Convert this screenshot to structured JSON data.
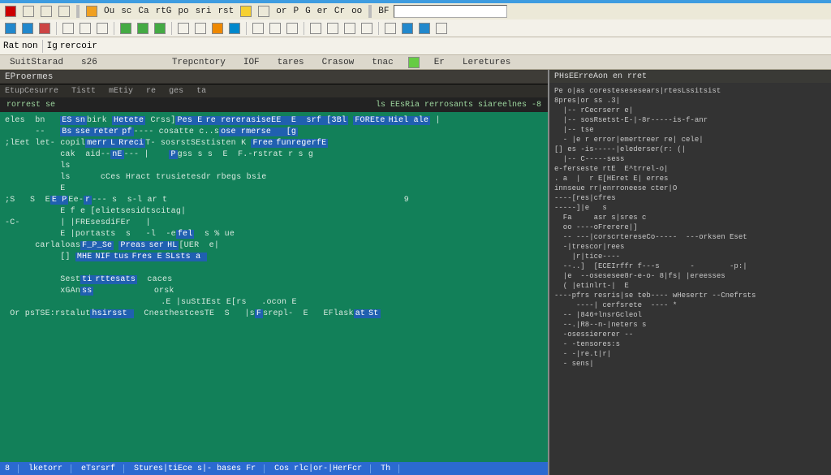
{
  "menubar": [
    "Ou",
    "sc",
    "Ca",
    "rtG",
    "po",
    "sri",
    "rst",
    "or",
    "P",
    "G",
    "er",
    "Cr",
    "oo",
    "BF"
  ],
  "toolbar2": [
    "Rat",
    "non",
    "Ig",
    "rercoir"
  ],
  "tabrow": [
    "SuitStarad",
    "s26",
    "Trepcntory",
    "IOF",
    "tares",
    "Crasow",
    "tnac",
    "Er",
    "Leretures"
  ],
  "panel": {
    "title": "EProermes",
    "sub": [
      "EtupCesurre",
      "Tistt",
      "mEtiy",
      "re",
      "ges",
      "ta"
    ],
    "head_left": "rorrest se",
    "head_right": "ls EEsRia rerrosants siareelnes -8"
  },
  "editor_lines": [
    "eles  bn   [ES][sn]birk [Hetete] Crss][Pes E][re rererasiseEE  E  srf [3Bl] [FOREte][Hiel ale] |",
    "      --   [Bs][sse][reter][pf]---- cosatte c..s[ose rmerse   [g]                              ",
    ";lEet let- copil[merr][L][Rreci]T- sosrstSEstisten K [Free][funregerfE]                         ",
    "           cak  aid--[nE]--- |    [P]gss s s  E  F.-rstrat r s g                                ",
    "           ls                                                                                   ",
    "           ls      cCes Hract trusietesdr rbegs bsie                                            ",
    "           E                                                                                    ",
    ";S   S  E[E P]Ee-[r]--- s  s-l ar t                                               9             ",
    "           E f e [elietsesidtscitag|                                                            ",
    "-C-        | |FREsesdiFEr   |                                                                   ",
    "           E |portasts  s   -l  -e[fel]  s % ue                                                 ",
    "      carlaloas[F_P_Se] [Preas][ser][HL][UER  e|                                                ",
    "           [] [MHE][NIF][tus][Fres E][SLsts a ]                                                 ",
    "                                                                                                ",
    "           Sest[ti][rttesats]  caces                                                            ",
    "           xGAn[ss]            orsk                                                             ",
    "                               .E |suStIEst E[rs   .ocon E                                      ",
    " Or psTSE:rstalut[hsirsst ]  CnesthestcesTE  S   |s[F]srepl-  E   EFlask[at][St]                "
  ],
  "status": [
    "8",
    "lketorr",
    "eTsrsrf",
    "Stures|tiEce s|- bases Fr",
    "Cos  rlc|or-|HerFcr",
    "Th"
  ],
  "right": {
    "title": "PHsEErreAon en rret",
    "lines": [
      "Pe o|as corestesesesears|rtesLssitsist",
      "8pres|or ss .3|",
      "  |-- rCecrserr e|",
      "  |-- sosRsetst-E-|-8r-----is-f-anr",
      "  |-- tse",
      "  - |e r error|emertreer re| cele|",
      "[] es -is-----|elederser(r: (|",
      "  |-- C-----sess",
      "e-ferseste rtE  E^trrel-o|",
      ". a  |  r E[HEret E| erres",
      "innseue rr|enrroneese cter|O",
      "----[res|cfres",
      "-----]|e   s",
      "  Fa     asr s|sres c",
      "  oo ----oFrerere|]",
      "  -- ---|corscrtereseCo-----  ---orksen Eset",
      "  -|trescor|rees",
      "    |r|tice----",
      "  --..]  [ECEIrffr f---s       -        -p:|",
      "  |e  --osesesee8r-e-o- 8|fs| |ereesses",
      "  ( |etinlrt-|  E",
      "----pfrs resris|se teb---- wHesertr --Cnefrsts",
      "     ----| cerfsrete  ---- * ",
      "  -- |846+lnsrGcleol",
      "  --.|R8--n-|neters s",
      "  -osessiererer --",
      "  - -tensores:s",
      "  - -|re.t|r|",
      "  - sens|"
    ]
  }
}
